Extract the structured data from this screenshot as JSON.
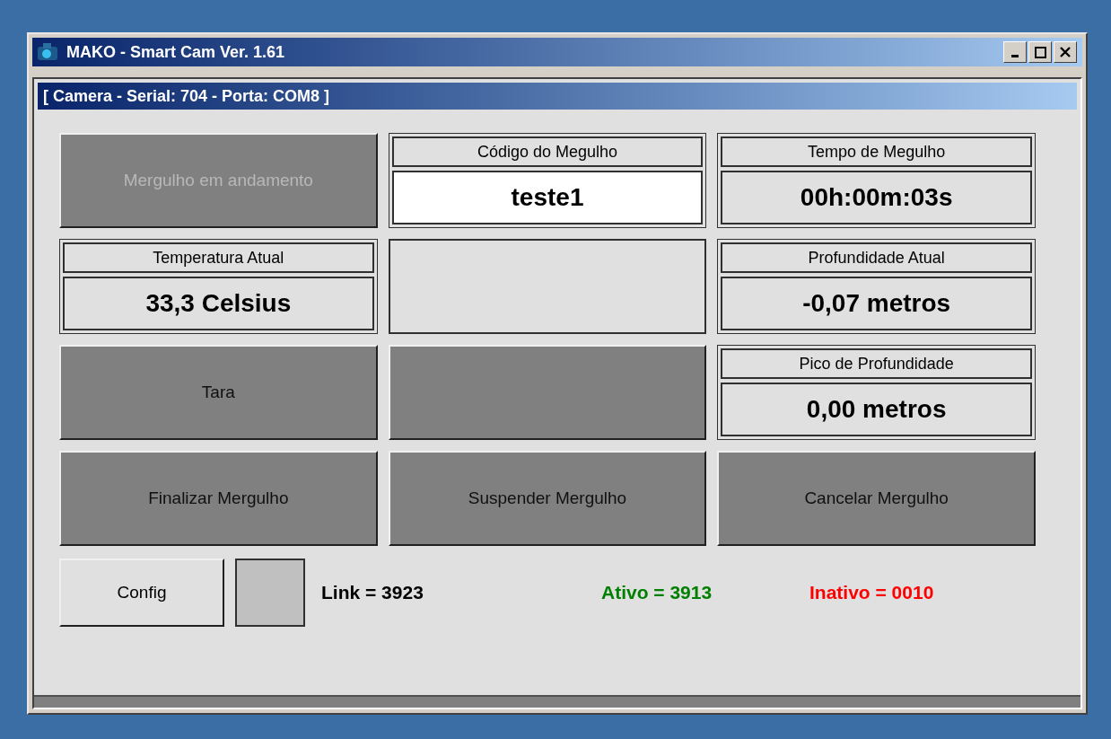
{
  "window": {
    "title": "MAKO - Smart Cam Ver. 1.61"
  },
  "header": "[ Camera - Serial: 704 - Porta: COM8 ]",
  "cells": [
    {
      "kind": "button",
      "label": "Mergulho em andamento",
      "disabled": true
    },
    {
      "kind": "readout",
      "label": "Código do Megulho",
      "value": "teste1",
      "editable": true
    },
    {
      "kind": "readout",
      "label": "Tempo de Megulho",
      "value": "00h:00m:03s",
      "editable": false
    },
    {
      "kind": "readout",
      "label": "Temperatura Atual",
      "value": "33,3 Celsius",
      "editable": false
    },
    {
      "kind": "empty"
    },
    {
      "kind": "readout",
      "label": "Profundidade Atual",
      "value": "-0,07 metros",
      "editable": false
    },
    {
      "kind": "button",
      "label": "Tara",
      "disabled": false
    },
    {
      "kind": "button"
    },
    {
      "kind": "readout",
      "label": "Pico de Profundidade",
      "value": "0,00 metros",
      "editable": false
    },
    {
      "kind": "button",
      "label": "Finalizar Mergulho",
      "disabled": false
    },
    {
      "kind": "button",
      "label": "Suspender Mergulho",
      "disabled": false
    },
    {
      "kind": "button",
      "label": "Cancelar Mergulho",
      "disabled": false
    }
  ],
  "config_button": "Config",
  "counters": [
    {
      "text": "Link = 3923",
      "color": "#000000"
    },
    {
      "text": "Ativo = 3913",
      "color": "#008000"
    },
    {
      "text": "Inativo = 0010",
      "color": "#ff0000"
    }
  ]
}
